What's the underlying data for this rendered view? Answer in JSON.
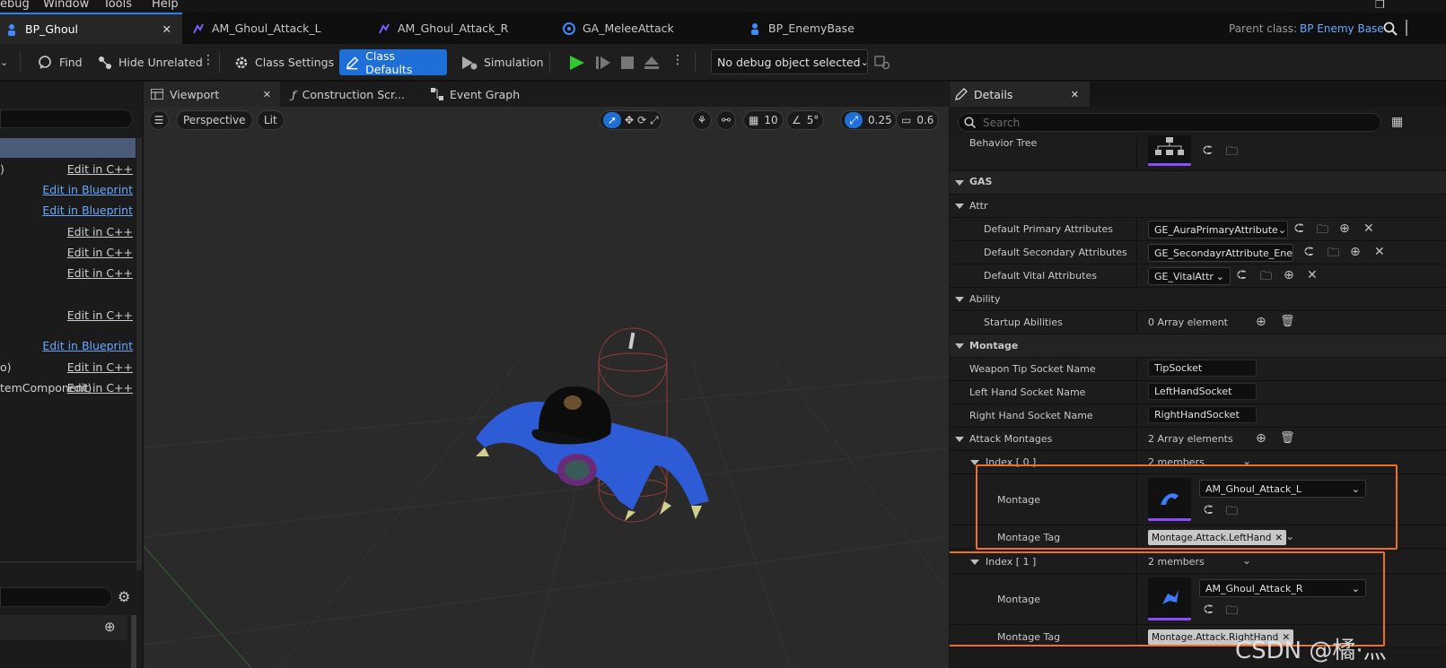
{
  "menu": {
    "items": [
      "ebug",
      "Window",
      "Tools",
      "Help"
    ]
  },
  "tabs": [
    {
      "label": "BP_Ghoul",
      "active": true
    },
    {
      "label": "AM_Ghoul_Attack_L"
    },
    {
      "label": "AM_Ghoul_Attack_R"
    },
    {
      "label": "GA_MeleeAttack"
    },
    {
      "label": "BP_EnemyBase"
    }
  ],
  "parent_class": {
    "label": "Parent class:",
    "value": "BP Enemy Base"
  },
  "toolbar": {
    "find": "Find",
    "hide_unrelated": "Hide Unrelated",
    "class_settings": "Class Settings",
    "class_defaults": "Class Defaults",
    "simulation": "Simulation",
    "debug_object": "No debug object selected"
  },
  "left_panel": {
    "rows": [
      {
        "left": ")",
        "link": "Edit in C++",
        "bp": false
      },
      {
        "left": "",
        "link": "Edit in Blueprint",
        "bp": true
      },
      {
        "left": "",
        "link": "Edit in Blueprint",
        "bp": true
      },
      {
        "left": "",
        "link": "Edit in C++",
        "bp": false
      },
      {
        "left": "",
        "link": "Edit in C++",
        "bp": false
      },
      {
        "left": "",
        "link": "Edit in C++",
        "bp": false
      },
      {
        "left": "",
        "link": "Edit in C++",
        "bp": false
      },
      {
        "left": "",
        "link": "Edit in Blueprint",
        "bp": true
      },
      {
        "left": "o)",
        "link": "Edit in C++",
        "bp": false
      },
      {
        "left": "temComponent)",
        "link": "Edit in C++",
        "bp": false
      }
    ]
  },
  "viewport_tabs": {
    "viewport": "Viewport",
    "construction": "Construction Scr...",
    "event_graph": "Event Graph"
  },
  "viewport_toolbar": {
    "perspective": "Perspective",
    "lit": "Lit",
    "grid_snap": "10",
    "rot_snap": "5°",
    "scale_snap": "0.25",
    "camera_speed": "0.6"
  },
  "details": {
    "title": "Details",
    "search_placeholder": "Search",
    "behavior_tree": "Behavior Tree",
    "gas": "GAS",
    "attr": "Attr",
    "default_primary": {
      "label": "Default Primary Attributes",
      "value": "GE_AuraPrimaryAttribute"
    },
    "default_secondary": {
      "label": "Default Secondary Attributes",
      "value": "GE_SecondayrAttribute_Enen"
    },
    "default_vital": {
      "label": "Default Vital Attributes",
      "value": "GE_VitalAttr"
    },
    "ability": "Ability",
    "startup_abilities": {
      "label": "Startup Abilities",
      "value": "0 Array element"
    },
    "montage_cat": "Montage",
    "weapon_tip": {
      "label": "Weapon Tip Socket Name",
      "value": "TipSocket"
    },
    "left_hand": {
      "label": "Left Hand Socket Name",
      "value": "LeftHandSocket"
    },
    "right_hand": {
      "label": "Right Hand Socket Name",
      "value": "RightHandSocket"
    },
    "attack_montages": {
      "label": "Attack Montages",
      "value": "2 Array elements"
    },
    "index0": {
      "label": "Index [ 0 ]",
      "value": "2 members",
      "montage_label": "Montage",
      "montage": "AM_Ghoul_Attack_L",
      "tag_label": "Montage Tag",
      "tag": "Montage.Attack.LeftHand"
    },
    "index1": {
      "label": "Index [ 1 ]",
      "value": "2 members",
      "montage_label": "Montage",
      "montage": "AM_Ghoul_Attack_R",
      "tag_label": "Montage Tag",
      "tag": "Montage.Attack.RightHand"
    }
  },
  "watermark": "CSDN @橘·灬",
  "colors": {
    "accent": "#1f6fd8",
    "highlight": "#f07020",
    "link": "#6aa8ff"
  }
}
